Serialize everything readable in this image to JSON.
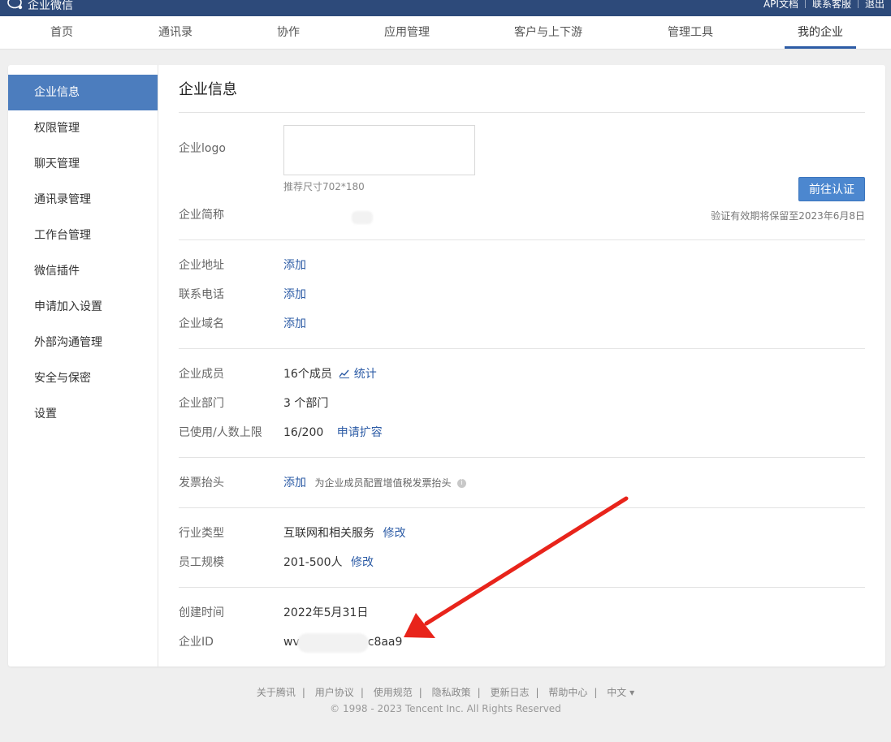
{
  "topbar": {
    "brand": "企业微信",
    "links": [
      "API文档",
      "联系客服",
      "退出"
    ]
  },
  "nav": {
    "items": [
      "首页",
      "通讯录",
      "协作",
      "应用管理",
      "客户与上下游",
      "管理工具",
      "我的企业"
    ],
    "active": "我的企业"
  },
  "sidebar": {
    "items": [
      "企业信息",
      "权限管理",
      "聊天管理",
      "通讯录管理",
      "工作台管理",
      "微信插件",
      "申请加入设置",
      "外部沟通管理",
      "安全与保密",
      "设置"
    ],
    "active": "企业信息"
  },
  "main": {
    "title": "企业信息",
    "logo": {
      "label": "企业logo",
      "hint": "推荐尺寸702*180"
    },
    "verify": {
      "button": "前往认证",
      "note": "验证有效期将保留至2023年6月8日"
    },
    "short_name": {
      "label": "企业简称"
    },
    "address": {
      "label": "企业地址",
      "action": "添加"
    },
    "phone": {
      "label": "联系电话",
      "action": "添加"
    },
    "domain": {
      "label": "企业域名",
      "action": "添加"
    },
    "members": {
      "label": "企业成员",
      "value": "16个成员",
      "action": "统计"
    },
    "departments": {
      "label": "企业部门",
      "value": "3 个部门"
    },
    "usage": {
      "label": "已使用/人数上限",
      "value": "16/200",
      "action": "申请扩容"
    },
    "invoice": {
      "label": "发票抬头",
      "action": "添加",
      "hint": "为企业成员配置增值税发票抬头"
    },
    "industry": {
      "label": "行业类型",
      "value": "互联网和相关服务",
      "action": "修改"
    },
    "staff_size": {
      "label": "员工规模",
      "value": "201-500人",
      "action": "修改"
    },
    "created": {
      "label": "创建时间",
      "value": "2022年5月31日"
    },
    "corp_id": {
      "label": "企业ID",
      "prefix": "wv",
      "suffix": "c8aa9"
    }
  },
  "footer": {
    "links": [
      "关于腾讯",
      "用户协议",
      "使用规范",
      "隐私政策",
      "更新日志",
      "帮助中心",
      "中文 ▾"
    ],
    "copyright": "© 1998 - 2023 Tencent Inc. All Rights Reserved"
  },
  "colors": {
    "topbar": "#2d4a7a",
    "accent": "#4c7dbe",
    "link": "#2d5ca6",
    "arrow": "#e8241b"
  }
}
